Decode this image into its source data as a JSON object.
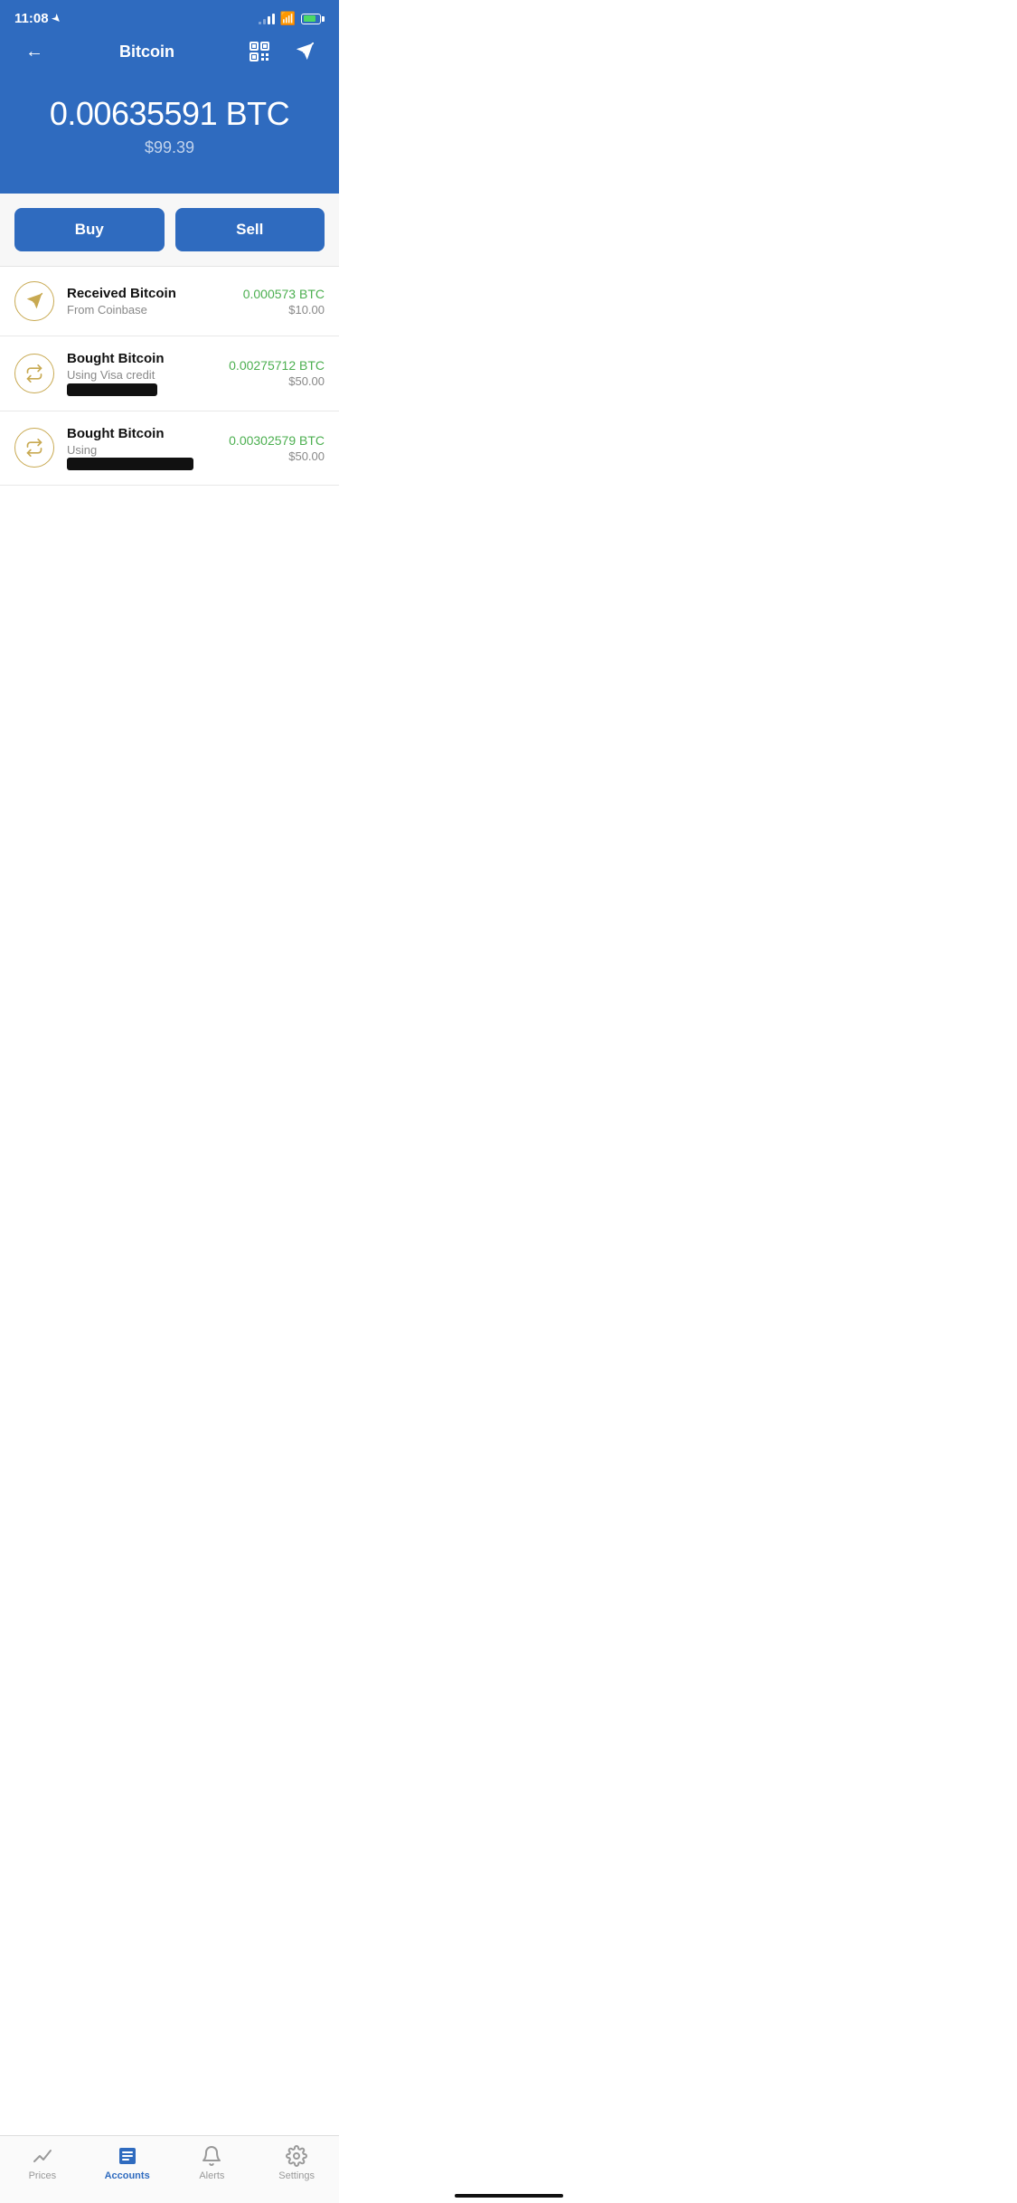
{
  "statusBar": {
    "time": "11:08",
    "locationArrow": true
  },
  "header": {
    "title": "Bitcoin",
    "backLabel": "←",
    "qrLabel": "QR",
    "sendLabel": "➤"
  },
  "balance": {
    "btc": "0.00635591 BTC",
    "usd": "$99.39"
  },
  "buttons": {
    "buy": "Buy",
    "sell": "Sell"
  },
  "transactions": [
    {
      "icon": "send",
      "title": "Received Bitcoin",
      "subtitle": "From Coinbase",
      "subtitleRedacted": false,
      "btcAmount": "0.000573 BTC",
      "usdAmount": "$10.00"
    },
    {
      "icon": "swap",
      "title": "Bought Bitcoin",
      "subtitle": "Using Visa credit",
      "subtitleRedacted": true,
      "btcAmount": "0.00275712 BTC",
      "usdAmount": "$50.00"
    },
    {
      "icon": "swap",
      "title": "Bought Bitcoin",
      "subtitle": "Using",
      "subtitleRedacted": true,
      "btcAmount": "0.00302579 BTC",
      "usdAmount": "$50.00"
    }
  ],
  "bottomNav": [
    {
      "id": "prices",
      "label": "Prices",
      "active": false
    },
    {
      "id": "accounts",
      "label": "Accounts",
      "active": true
    },
    {
      "id": "alerts",
      "label": "Alerts",
      "active": false
    },
    {
      "id": "settings",
      "label": "Settings",
      "active": false
    }
  ]
}
